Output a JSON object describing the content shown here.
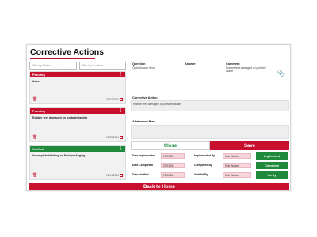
{
  "page": {
    "title": "Corrective Actions",
    "back_label": "Back to Home"
  },
  "filters": {
    "status": {
      "placeholder": "Filter by Status..."
    },
    "location": {
      "placeholder": "Filter by Location..."
    }
  },
  "cards": [
    {
      "status": "Pending",
      "status_color": "#c8102e",
      "text": "Asset",
      "date": "03/07/2024"
    },
    {
      "status": "Pending",
      "status_color": "#c8102e",
      "text": "Rubber feet damaged on portable ladder",
      "date": "08/25/2024"
    },
    {
      "status": "Verified",
      "status_color": "#1f8a3b",
      "text": "Incomplete labeling on fluid packaging",
      "date": "02/14/2024"
    }
  ],
  "detail": {
    "question_label": "Question",
    "question_value": "Open Answer Item",
    "answer_label": "Answer",
    "comment_label": "Comment",
    "comment_value": "Rubber feet damaged on portable ladder",
    "corrective_action_label": "Corrective Action",
    "corrective_action_value": "Rubber feet damaged on portable ladder",
    "abatement_plan_label": "Abatement Plan",
    "abatement_plan_value": "",
    "close_label": "Close",
    "save_label": "Save"
  },
  "rows": [
    {
      "label": "Date Implemented",
      "date": "03/03/24",
      "by_label": "Implemented By",
      "name": "Kyle Worker",
      "action": "Implement"
    },
    {
      "label": "Date Completed",
      "date": "03/03/24",
      "by_label": "Completed By",
      "name": "Kyle Worker",
      "action": "Complete"
    },
    {
      "label": "Date Verified",
      "date": "03/03/24",
      "by_label": "Verified By",
      "name": "Kyle Worker",
      "action": "Verify"
    }
  ],
  "colors": {
    "accent_red": "#c8102e",
    "accent_green": "#1f8a3b",
    "field_pink": "#f6d6dc"
  },
  "icons": {
    "filter_chevron": "chevron-down-icon",
    "card_menu": "kebab-icon",
    "delete": "trash-icon",
    "calendar": "calendar-icon",
    "attachment": "paperclip-icon"
  }
}
